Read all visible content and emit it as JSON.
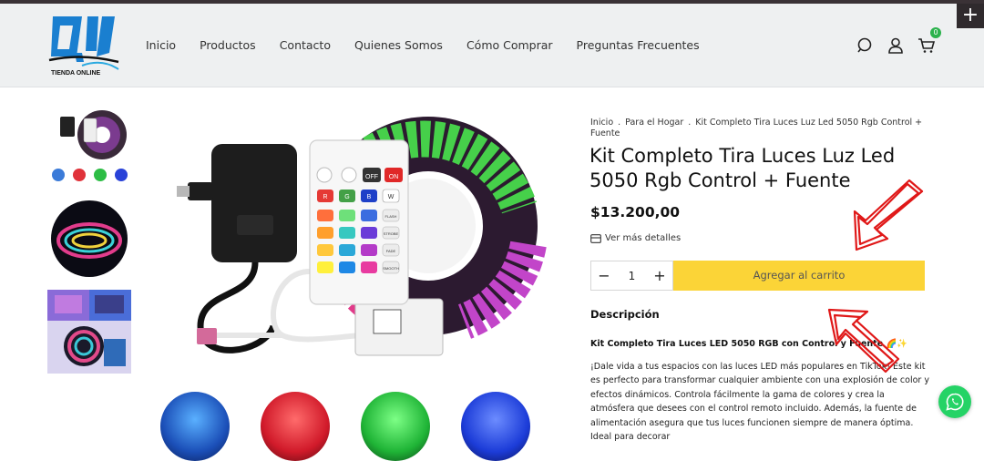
{
  "header": {
    "logo_text": "TIENDA ONLINE",
    "nav": [
      "Inicio",
      "Productos",
      "Contacto",
      "Quienes Somos",
      "Cómo Comprar",
      "Preguntas Frecuentes"
    ],
    "cart_count": "0",
    "plus_label": "+"
  },
  "breadcrumb": {
    "items": [
      "Inicio",
      "Para el Hogar",
      "Kit Completo Tira Luces Luz Led 5050 Rgb Control + Fuente"
    ]
  },
  "product": {
    "title": "Kit Completo Tira Luces Luz Led 5050 Rgb Control + Fuente",
    "price": "$13.200,00",
    "more_details": "Ver más detalles",
    "quantity": "1",
    "qty_minus": "−",
    "qty_plus": "+",
    "add_to_cart": "Agregar al carrito",
    "description_title": "Descripción",
    "description_heading": "Kit Completo Tira Luces LED 5050 RGB con Control y Fuente 🌈✨",
    "description_body": "¡Dale vida a tus espacios con las luces LED más populares en TikTok! Este kit es perfecto para transformar cualquier ambiente con una explosión de color y efectos dinámicos. Controla fácilmente la gama de colores y crea la atmósfera que desees con el control remoto incluido. Además, la fuente de alimentación asegura que tus luces funcionen siempre de manera óptima. Ideal para decorar"
  },
  "remote": {
    "off": "OFF",
    "on": "ON",
    "r": "R",
    "g": "G",
    "b": "B",
    "w": "W",
    "flash": "FLASH",
    "strobe": "STROBE",
    "fade": "FADE",
    "smooth": "SMOOTH"
  },
  "colors": {
    "accent_yellow": "#fbd437",
    "cart_badge": "#2bb24c",
    "whatsapp": "#25d366",
    "logo_blue": "#1a7fd0"
  }
}
